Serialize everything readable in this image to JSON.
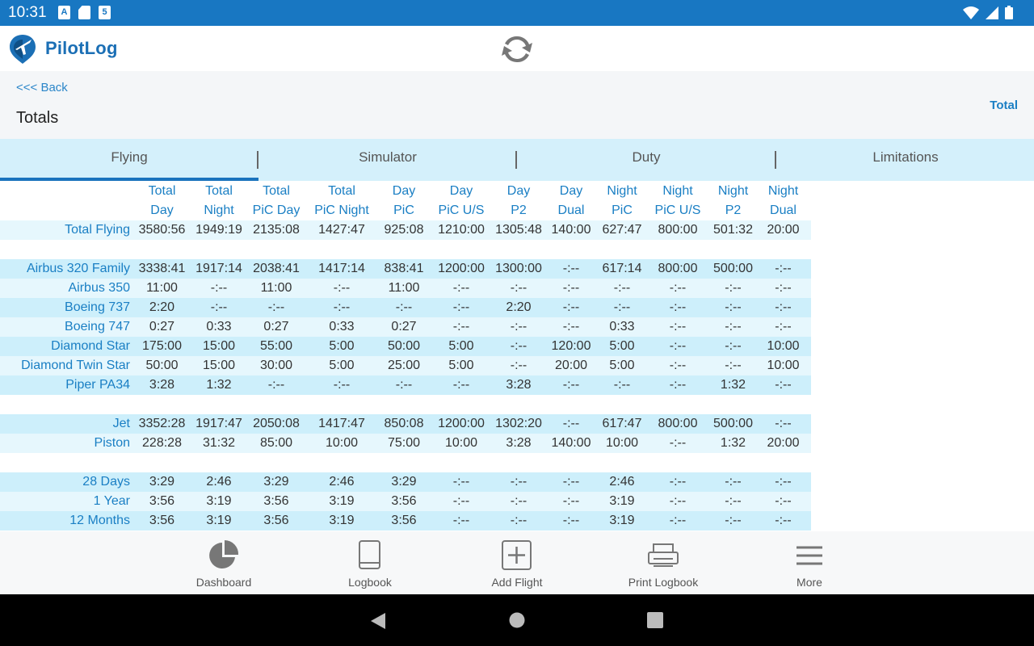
{
  "status_bar": {
    "time": "10:31",
    "notification_icons": [
      "A",
      "sd-card-icon",
      "5"
    ]
  },
  "app": {
    "name": "PilotLog",
    "brand_color": "#1b6fb5"
  },
  "header": {
    "back_label": "<<< Back",
    "page_title": "Totals",
    "right_label": "Total"
  },
  "tabs": [
    {
      "label": "Flying",
      "active": true
    },
    {
      "label": "Simulator",
      "active": false
    },
    {
      "label": "Duty",
      "active": false
    },
    {
      "label": "Limitations",
      "active": false
    }
  ],
  "table": {
    "columns": [
      [
        "Total",
        "Day"
      ],
      [
        "Total",
        "Night"
      ],
      [
        "Total",
        "PiC Day"
      ],
      [
        "Total",
        "PiC Night"
      ],
      [
        "Day",
        "PiC"
      ],
      [
        "Day",
        "PiC U/S"
      ],
      [
        "Day",
        "P2"
      ],
      [
        "Day",
        "Dual"
      ],
      [
        "Night",
        "PiC"
      ],
      [
        "Night",
        "PiC U/S"
      ],
      [
        "Night",
        "P2"
      ],
      [
        "Night",
        "Dual"
      ]
    ],
    "rows": [
      {
        "label": "Total Flying",
        "values": [
          "3580:56",
          "1949:19",
          "2135:08",
          "1427:47",
          "925:08",
          "1210:00",
          "1305:48",
          "140:00",
          "627:47",
          "800:00",
          "501:32",
          "20:00"
        ]
      },
      {
        "blank": true
      },
      {
        "label": "Airbus 320 Family",
        "values": [
          "3338:41",
          "1917:14",
          "2038:41",
          "1417:14",
          "838:41",
          "1200:00",
          "1300:00",
          "-:--",
          "617:14",
          "800:00",
          "500:00",
          "-:--"
        ]
      },
      {
        "label": "Airbus 350",
        "values": [
          "11:00",
          "-:--",
          "11:00",
          "-:--",
          "11:00",
          "-:--",
          "-:--",
          "-:--",
          "-:--",
          "-:--",
          "-:--",
          "-:--"
        ]
      },
      {
        "label": "Boeing 737",
        "values": [
          "2:20",
          "-:--",
          "-:--",
          "-:--",
          "-:--",
          "-:--",
          "2:20",
          "-:--",
          "-:--",
          "-:--",
          "-:--",
          "-:--"
        ]
      },
      {
        "label": "Boeing 747",
        "values": [
          "0:27",
          "0:33",
          "0:27",
          "0:33",
          "0:27",
          "-:--",
          "-:--",
          "-:--",
          "0:33",
          "-:--",
          "-:--",
          "-:--"
        ]
      },
      {
        "label": "Diamond Star",
        "values": [
          "175:00",
          "15:00",
          "55:00",
          "5:00",
          "50:00",
          "5:00",
          "-:--",
          "120:00",
          "5:00",
          "-:--",
          "-:--",
          "10:00"
        ]
      },
      {
        "label": "Diamond Twin Star",
        "values": [
          "50:00",
          "15:00",
          "30:00",
          "5:00",
          "25:00",
          "5:00",
          "-:--",
          "20:00",
          "5:00",
          "-:--",
          "-:--",
          "10:00"
        ]
      },
      {
        "label": "Piper PA34",
        "values": [
          "3:28",
          "1:32",
          "-:--",
          "-:--",
          "-:--",
          "-:--",
          "3:28",
          "-:--",
          "-:--",
          "-:--",
          "1:32",
          "-:--"
        ]
      },
      {
        "blank": true
      },
      {
        "label": "Jet",
        "values": [
          "3352:28",
          "1917:47",
          "2050:08",
          "1417:47",
          "850:08",
          "1200:00",
          "1302:20",
          "-:--",
          "617:47",
          "800:00",
          "500:00",
          "-:--"
        ]
      },
      {
        "label": "Piston",
        "values": [
          "228:28",
          "31:32",
          "85:00",
          "10:00",
          "75:00",
          "10:00",
          "3:28",
          "140:00",
          "10:00",
          "-:--",
          "1:32",
          "20:00"
        ]
      },
      {
        "blank": true
      },
      {
        "label": "28 Days",
        "values": [
          "3:29",
          "2:46",
          "3:29",
          "2:46",
          "3:29",
          "-:--",
          "-:--",
          "-:--",
          "2:46",
          "-:--",
          "-:--",
          "-:--"
        ]
      },
      {
        "label": "1 Year",
        "values": [
          "3:56",
          "3:19",
          "3:56",
          "3:19",
          "3:56",
          "-:--",
          "-:--",
          "-:--",
          "3:19",
          "-:--",
          "-:--",
          "-:--"
        ]
      },
      {
        "label": "12 Months",
        "values": [
          "3:56",
          "3:19",
          "3:56",
          "3:19",
          "3:56",
          "-:--",
          "-:--",
          "-:--",
          "3:19",
          "-:--",
          "-:--",
          "-:--"
        ]
      }
    ]
  },
  "bottom_nav": [
    {
      "label": "Dashboard",
      "icon": "pie-chart-icon"
    },
    {
      "label": "Logbook",
      "icon": "book-icon"
    },
    {
      "label": "Add Flight",
      "icon": "add-box-icon"
    },
    {
      "label": "Print Logbook",
      "icon": "printer-icon"
    },
    {
      "label": "More",
      "icon": "menu-icon"
    }
  ],
  "colors": {
    "status_bar": "#1877c2",
    "tab_bar": "#d4f0fb",
    "row_dark": "#cdeffb",
    "row_light": "#e6f7fd",
    "label_blue": "#1a7fc4"
  }
}
